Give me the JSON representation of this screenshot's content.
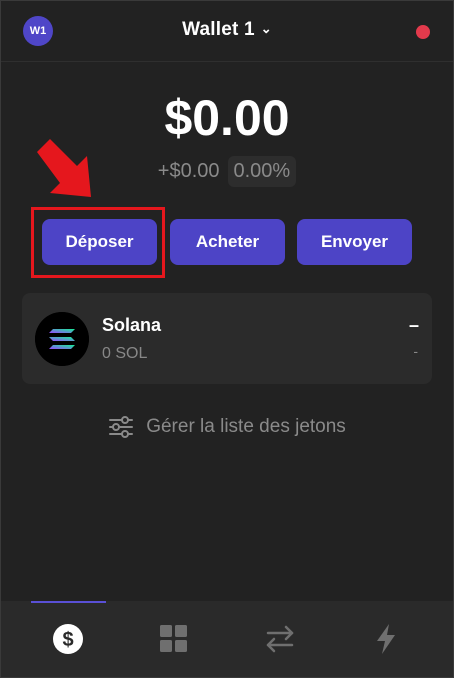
{
  "header": {
    "avatar_label": "W1",
    "wallet_name": "Wallet 1",
    "chevron": "⌄"
  },
  "balance": {
    "total": "$0.00",
    "change": "+$0.00",
    "change_pct": "0.00%"
  },
  "actions": {
    "deposit": "Déposer",
    "buy": "Acheter",
    "send": "Envoyer"
  },
  "tokens": [
    {
      "name": "Solana",
      "amount": "0 SOL",
      "value": "–",
      "change": "-"
    }
  ],
  "manage": {
    "label": "Gérer la liste des jetons"
  },
  "nav": {
    "items": [
      {
        "icon": "dollar-icon",
        "active": true
      },
      {
        "icon": "grid-icon",
        "active": false
      },
      {
        "icon": "swap-icon",
        "active": false
      },
      {
        "icon": "lightning-icon",
        "active": false
      }
    ]
  },
  "colors": {
    "accent": "#4d44c6",
    "status": "#e33a4c",
    "annotation": "#e5171d"
  }
}
